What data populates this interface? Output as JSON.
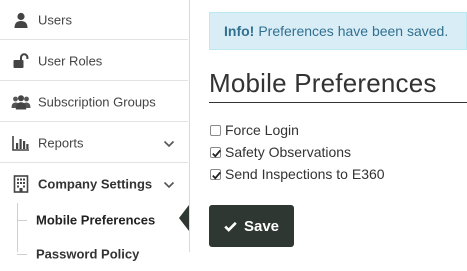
{
  "sidebar": {
    "items": [
      {
        "label": "Users",
        "icon": "user-icon"
      },
      {
        "label": "User Roles",
        "icon": "unlock-icon"
      },
      {
        "label": "Subscription Groups",
        "icon": "users-group-icon"
      },
      {
        "label": "Reports",
        "icon": "bar-chart-icon"
      },
      {
        "label": "Company Settings",
        "icon": "building-icon"
      }
    ],
    "sub_items": [
      {
        "label": "Mobile Preferences",
        "active": true
      },
      {
        "label": "Password Policy",
        "active": false
      }
    ]
  },
  "alert": {
    "strong": "Info!",
    "message": "Preferences have been saved."
  },
  "page": {
    "title": "Mobile Preferences"
  },
  "preferences": [
    {
      "label": "Force Login",
      "checked": false
    },
    {
      "label": "Safety Observations",
      "checked": true
    },
    {
      "label": "Send Inspections to E360",
      "checked": true
    }
  ],
  "actions": {
    "save_label": "Save"
  },
  "colors": {
    "button_bg": "#2f3733",
    "alert_bg": "#d9edf7",
    "alert_text": "#31708f"
  }
}
